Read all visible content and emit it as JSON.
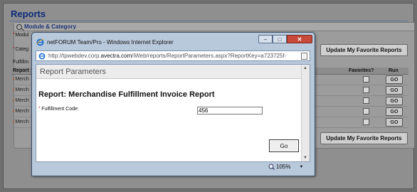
{
  "background": {
    "page_title": "Reports",
    "panel_header": "Module & Category",
    "labels": {
      "module": "Modul",
      "category": "Categ",
      "fulfillment": "Fulfillm",
      "report": "Report"
    },
    "favorite_button_label": "Update My Favorite Reports",
    "grid_headers": {
      "favorites": "Favorites?",
      "run": "Run"
    },
    "rows": [
      {
        "name": "Merch",
        "go": "GO"
      },
      {
        "name": "Merch",
        "go": "GO"
      },
      {
        "name": "Merch",
        "go": "GO"
      },
      {
        "name": "Merch",
        "go": "GO"
      },
      {
        "name": "Merch",
        "go": "GO"
      }
    ]
  },
  "ie_window": {
    "title": "netFORUM Team/Pro - Windows Internet Explorer",
    "address_prefix": "http://tpwebdev.corp.",
    "address_domain": "avectra.com",
    "address_suffix": "/iWeb/reports/ReportParameters.aspx?ReportKey=a723725f-",
    "content_header": "Report Parameters",
    "report_title": "Report: Merchandise Fulfillment Invoice Report",
    "field_label": "Fulfillment Code:",
    "field_value": "456",
    "go_label": "Go",
    "zoom_level": "105%",
    "controls": {
      "minimize": "–",
      "maximize": "□",
      "close": "✕"
    }
  },
  "icons": [
    "ie-logo-icon",
    "magnifier-icon",
    "page-icon",
    "zoom-icon"
  ],
  "colors": {
    "title_blue": "#0d2a7a",
    "close_red": "#c74a3b",
    "chrome_blue": "#b9c9dc"
  }
}
